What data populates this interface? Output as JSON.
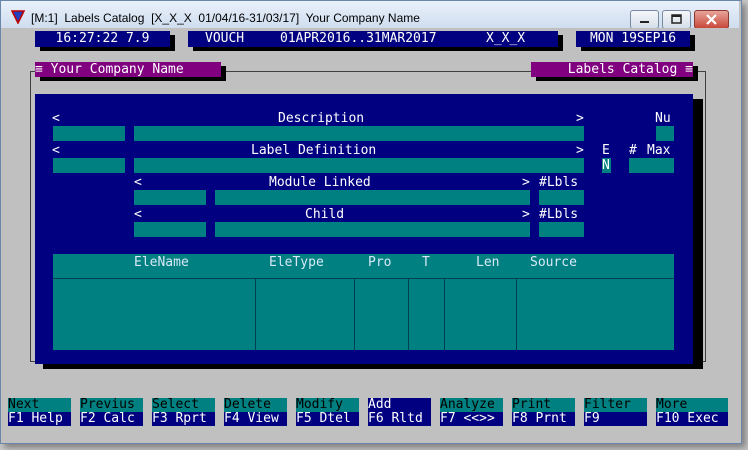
{
  "window": {
    "title": "[M:1]  Labels Catalog  [X_X_X  01/04/16-31/03/17]  Your Company Name"
  },
  "status": {
    "time_version": "16:27:22 7.9",
    "voucher": "VOUCH",
    "period": "01APR2016..31MAR2017",
    "company_code": "X_X_X",
    "date": "MON 19SEP16"
  },
  "panel": {
    "company_label": "≡ Your Company Name",
    "module_label": "Labels Catalog ≡"
  },
  "form": {
    "arrow_left": "<",
    "arrow_right": ">",
    "description_label": "Description",
    "nu_label": "Nu",
    "label_definition_label": "Label Definition",
    "e_label": "E",
    "e_value": "N",
    "hash_label": "#",
    "max_label": "Max",
    "module_linked_label": "Module Linked",
    "lbls_label": "#Lbls",
    "child_label": "Child"
  },
  "grid": {
    "columns": [
      "EleName",
      "EleType",
      "Pro",
      "T",
      "Len",
      "Source"
    ]
  },
  "function_keys": [
    {
      "top": "Next",
      "bottom": "F1 Help"
    },
    {
      "top": "Previus",
      "bottom": "F2 Calc"
    },
    {
      "top": "Select",
      "bottom": "F3 Rprt"
    },
    {
      "top": "Delete",
      "bottom": "F4 View"
    },
    {
      "top": "Modify",
      "bottom": "F5 Dtel"
    },
    {
      "top": "Add",
      "bottom": "F6 Rltd"
    },
    {
      "top": "Analyze",
      "bottom": "F7 <<>>"
    },
    {
      "top": "Print",
      "bottom": "F8 Prnt"
    },
    {
      "top": "Filter",
      "bottom": "F9"
    },
    {
      "top": "More",
      "bottom": "F10 Exec"
    }
  ],
  "colors": {
    "navy": "#000080",
    "teal": "#008080",
    "purple": "#800080",
    "grey": "#c0c0c0"
  }
}
